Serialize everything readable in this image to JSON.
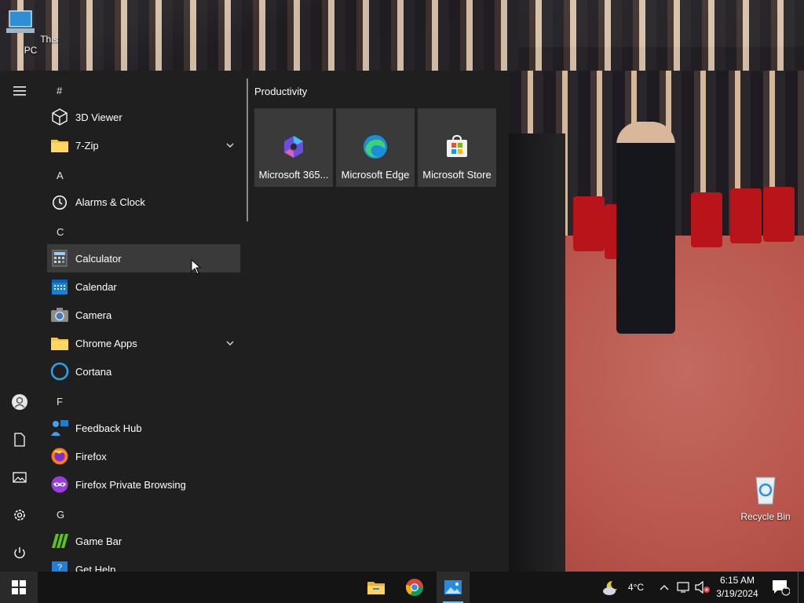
{
  "desktop": {
    "icons": [
      {
        "label": "This PC"
      },
      {
        "label": "Recycle Bin"
      }
    ]
  },
  "start_menu": {
    "rail": [
      "hamburger-menu",
      "user-account",
      "documents",
      "pictures",
      "settings",
      "power"
    ],
    "letters": {
      "hash": "#",
      "a": "A",
      "c": "C",
      "f": "F",
      "g": "G"
    },
    "apps": [
      {
        "label": "3D Viewer",
        "icon": "3d-viewer-icon"
      },
      {
        "label": "7-Zip",
        "icon": "folder-icon",
        "expandable": true
      },
      {
        "label": "Alarms & Clock",
        "icon": "alarm-clock-icon"
      },
      {
        "label": "Calculator",
        "icon": "calculator-icon"
      },
      {
        "label": "Calendar",
        "icon": "calendar-icon"
      },
      {
        "label": "Camera",
        "icon": "camera-icon"
      },
      {
        "label": "Chrome Apps",
        "icon": "folder-icon",
        "expandable": true
      },
      {
        "label": "Cortana",
        "icon": "cortana-icon"
      },
      {
        "label": "Feedback Hub",
        "icon": "feedback-hub-icon"
      },
      {
        "label": "Firefox",
        "icon": "firefox-icon"
      },
      {
        "label": "Firefox Private Browsing",
        "icon": "firefox-private-icon"
      },
      {
        "label": "Game Bar",
        "icon": "game-bar-icon"
      },
      {
        "label": "Get Help",
        "icon": "get-help-icon"
      }
    ],
    "tiles_group": "Productivity",
    "tiles": [
      {
        "label": "Microsoft 365...",
        "icon": "microsoft-365-icon"
      },
      {
        "label": "Microsoft Edge",
        "icon": "edge-icon"
      },
      {
        "label": "Microsoft Store",
        "icon": "store-icon"
      }
    ]
  },
  "taskbar": {
    "pinned": [
      "file-explorer-icon",
      "chrome-icon",
      "photos-icon"
    ],
    "weather": {
      "temp": "4°C"
    },
    "clock": {
      "time": "6:15 AM",
      "date": "3/19/2024"
    },
    "notifications_count": "1",
    "accent_color": "#76b9ed"
  }
}
